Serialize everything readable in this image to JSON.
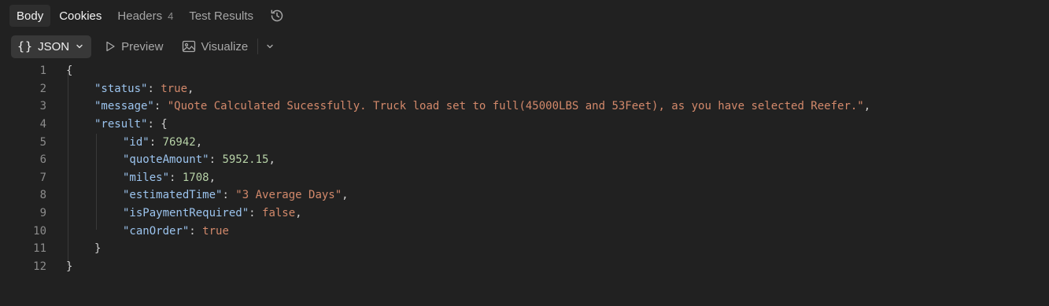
{
  "tabs": [
    {
      "label": "Body",
      "active": true
    },
    {
      "label": "Cookies",
      "active": false
    },
    {
      "label": "Headers",
      "badge": "4",
      "active": false
    },
    {
      "label": "Test Results",
      "active": false
    }
  ],
  "toolbar": {
    "format_label": "JSON",
    "preview_label": "Preview",
    "visualize_label": "Visualize"
  },
  "icons": {
    "history": "history-icon",
    "format": "braces-icon",
    "preview": "play-triangle-icon",
    "visualize": "image-icon",
    "chevron": "chevron-down-icon"
  },
  "colors": {
    "background": "#212121",
    "key": "#9cc4ee",
    "string": "#d3896b",
    "number": "#b6d1a6",
    "boolean": "#d3896b"
  },
  "code_lines": [
    {
      "n": "1"
    },
    {
      "n": "2",
      "key": "\"status\"",
      "value": "true",
      "type": "b"
    },
    {
      "n": "3",
      "key": "\"message\"",
      "value": "\"Quote Calculated Sucessfully. Truck load set to full(45000LBS and 53Feet), as you have selected Reefer.\"",
      "type": "s"
    },
    {
      "n": "4",
      "key": "\"result\"",
      "value": "{",
      "type": "p"
    },
    {
      "n": "5",
      "key": "\"id\"",
      "value": "76942",
      "type": "n"
    },
    {
      "n": "6",
      "key": "\"quoteAmount\"",
      "value": "5952.15",
      "type": "n"
    },
    {
      "n": "7",
      "key": "\"miles\"",
      "value": "1708",
      "type": "n"
    },
    {
      "n": "8",
      "key": "\"estimatedTime\"",
      "value": "\"3 Average Days\"",
      "type": "s"
    },
    {
      "n": "9",
      "key": "\"isPaymentRequired\"",
      "value": "false",
      "type": "b"
    },
    {
      "n": "10",
      "key": "\"canOrder\"",
      "value": "true",
      "type": "b"
    },
    {
      "n": "11",
      "text": "}"
    },
    {
      "n": "12",
      "text": "}"
    }
  ],
  "open_brace": "{"
}
